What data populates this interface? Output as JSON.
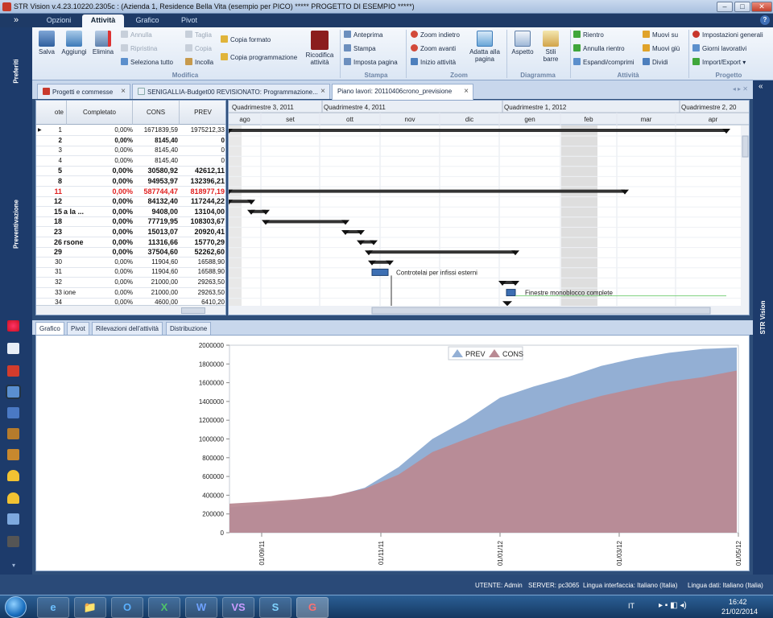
{
  "titlebar": {
    "title": "STR Vision v.4.23.10220.2305c : (Azienda 1, Residence Bella Vita (esempio per PICO) ***** PROGETTO DI ESEMPIO *****)",
    "minimize": "–",
    "maximize": "□",
    "close": "✕"
  },
  "quick_toggle": "»",
  "ribbon_tabs": [
    "Opzioni",
    "Attività",
    "Grafico",
    "Pivot"
  ],
  "help": "?",
  "ribbon": {
    "modifica": {
      "salva": "Salva",
      "aggiungi": "Aggiungi",
      "elimina": "Elimina",
      "annulla": "Annulla",
      "ripristina": "Ripristina",
      "seleziona_tutto": "Seleziona tutto",
      "taglia": "Taglia",
      "copia": "Copia",
      "incolla": "Incolla",
      "copia_formato": "Copia formato",
      "copia_programmazione": "Copia programmazione",
      "ricodifica": "Ricodifica attività",
      "label": "Modifica"
    },
    "stampa": {
      "anteprima": "Anteprima",
      "stampa": "Stampa",
      "imposta_pagina": "Imposta pagina",
      "label": "Stampa"
    },
    "zoom": {
      "indietro": "Zoom indietro",
      "avanti": "Zoom avanti",
      "inizio_attivita": "Inizio attività",
      "adatta": "Adatta alla pagina",
      "label": "Zoom"
    },
    "diagramma": {
      "aspetto": "Aspetto",
      "stili_barre": "Stili barre",
      "label": "Diagramma"
    },
    "attivita": {
      "rientro": "Rientro",
      "annulla_rientro": "Annulla rientro",
      "espandi": "Espandi/comprimi",
      "muovi_su": "Muovi su",
      "muovi_giu": "Muovi giù",
      "dividi": "Dividi",
      "label": "Attività"
    },
    "progetto": {
      "impostazioni": "Impostazioni generali",
      "giorni": "Giorni lavorativi",
      "import_export": "Import/Export",
      "label": "Progetto"
    }
  },
  "left_sidebar": {
    "top_label": "Preferiti",
    "mid_label": "Preventivazione"
  },
  "right_sidebar": {
    "label": "STR Vision",
    "collapse": "«"
  },
  "document_tabs": [
    {
      "label": "Progetti e commesse"
    },
    {
      "label": "SENIGALLIA-Budget00 REVISIONATO: Programmazione..."
    },
    {
      "label": "Piano lavori: 20110406crono_previsione"
    }
  ],
  "tab_close": "×",
  "grid": {
    "headers": [
      "ote",
      "Completato",
      "CONS",
      "PREV"
    ],
    "rows": [
      {
        "n": "1",
        "name": "",
        "pct": "0,00%",
        "cons": "1671839,59",
        "prev": "1975212,33",
        "style": "normal"
      },
      {
        "n": "2",
        "name": "",
        "pct": "0,00%",
        "cons": "8145,40",
        "prev": "0",
        "style": "semibold"
      },
      {
        "n": "3",
        "name": "",
        "pct": "0,00%",
        "cons": "8145,40",
        "prev": "0",
        "style": "normal"
      },
      {
        "n": "4",
        "name": "",
        "pct": "0,00%",
        "cons": "8145,40",
        "prev": "0",
        "style": "normal"
      },
      {
        "n": "5",
        "name": "",
        "pct": "0,00%",
        "cons": "30580,92",
        "prev": "42612,11",
        "style": "bold"
      },
      {
        "n": "8",
        "name": "",
        "pct": "0,00%",
        "cons": "94953,97",
        "prev": "132396,21",
        "style": "bold"
      },
      {
        "n": "11",
        "name": "",
        "pct": "0,00%",
        "cons": "587744,47",
        "prev": "818977,19",
        "style": "red"
      },
      {
        "n": "12",
        "name": "",
        "pct": "0,00%",
        "cons": "84132,40",
        "prev": "117244,22",
        "style": "bold"
      },
      {
        "n": "15",
        "name": "a la ...",
        "pct": "0,00%",
        "cons": "9408,00",
        "prev": "13104,00",
        "style": "bold"
      },
      {
        "n": "18",
        "name": "",
        "pct": "0,00%",
        "cons": "77719,95",
        "prev": "108303,67",
        "style": "bold"
      },
      {
        "n": "23",
        "name": "",
        "pct": "0,00%",
        "cons": "15013,07",
        "prev": "20920,41",
        "style": "bold"
      },
      {
        "n": "26",
        "name": "rsone",
        "pct": "0,00%",
        "cons": "11316,66",
        "prev": "15770,29",
        "style": "bold"
      },
      {
        "n": "29",
        "name": "",
        "pct": "0,00%",
        "cons": "37504,60",
        "prev": "52262,60",
        "style": "bold"
      },
      {
        "n": "30",
        "name": "",
        "pct": "0,00%",
        "cons": "11904,60",
        "prev": "16588,90",
        "style": "normal"
      },
      {
        "n": "31",
        "name": "",
        "pct": "0,00%",
        "cons": "11904,60",
        "prev": "16588,90",
        "style": "normal"
      },
      {
        "n": "32",
        "name": "",
        "pct": "0,00%",
        "cons": "21000,00",
        "prev": "29263,50",
        "style": "normal"
      },
      {
        "n": "33",
        "name": "ione",
        "pct": "0,00%",
        "cons": "21000,00",
        "prev": "29263,50",
        "style": "normal"
      },
      {
        "n": "34",
        "name": "",
        "pct": "0,00%",
        "cons": "4600,00",
        "prev": "6410,20",
        "style": "normal"
      }
    ]
  },
  "gantt": {
    "quadrimesters": [
      "Quadrimestre 3, 2011",
      "Quadrimestre 4, 2011",
      "Quadrimestre 1, 2012",
      "Quadrimestre 2, 20"
    ],
    "months": [
      "ago",
      "set",
      "ott",
      "nov",
      "dic",
      "gen",
      "feb",
      "mar",
      "apr"
    ],
    "bar_labels": {
      "controtelai": "Controtelai per infissi esterni",
      "finestre": "Finestre monoblocco complete"
    }
  },
  "bottom_tabs": [
    "Grafico",
    "Pivot",
    "Rilevazioni dell'attività",
    "Distribuzione"
  ],
  "chart_data": {
    "type": "area",
    "series": [
      {
        "name": "PREV",
        "color": "#93afd4",
        "values": [
          270000,
          300000,
          340000,
          380000,
          480000,
          700000,
          1000000,
          1200000,
          1440000,
          1560000,
          1660000,
          1780000,
          1860000,
          1920000,
          1960000,
          1975000
        ]
      },
      {
        "name": "CONS",
        "color": "#b98a93",
        "values": [
          310000,
          330000,
          355000,
          390000,
          470000,
          620000,
          860000,
          1000000,
          1130000,
          1240000,
          1360000,
          1460000,
          1540000,
          1610000,
          1660000,
          1730000
        ]
      }
    ],
    "x_tick_labels": [
      "01/09/11",
      "01/11/11",
      "01/01/12",
      "01/03/12",
      "01/05/12"
    ],
    "ylim": [
      0,
      2000000
    ],
    "y_ticks": [
      "0",
      "200000",
      "400000",
      "600000",
      "800000",
      "1000000",
      "1200000",
      "1400000",
      "1600000",
      "1800000",
      "2000000"
    ],
    "legend_position": "top"
  },
  "status": {
    "utente": "UTENTE: Admin",
    "server": "SERVER: pc3065",
    "lingua_int": "Lingua interfaccia: Italiano (Italia)",
    "lingua_dati": "Lingua dati: Italiano (Italia)"
  },
  "taskbar": {
    "apps": [
      "e",
      "📁",
      "O",
      "X",
      "W",
      "VS",
      "S",
      "G"
    ],
    "lang": "IT",
    "time": "16:42",
    "date": "21/02/2014"
  }
}
